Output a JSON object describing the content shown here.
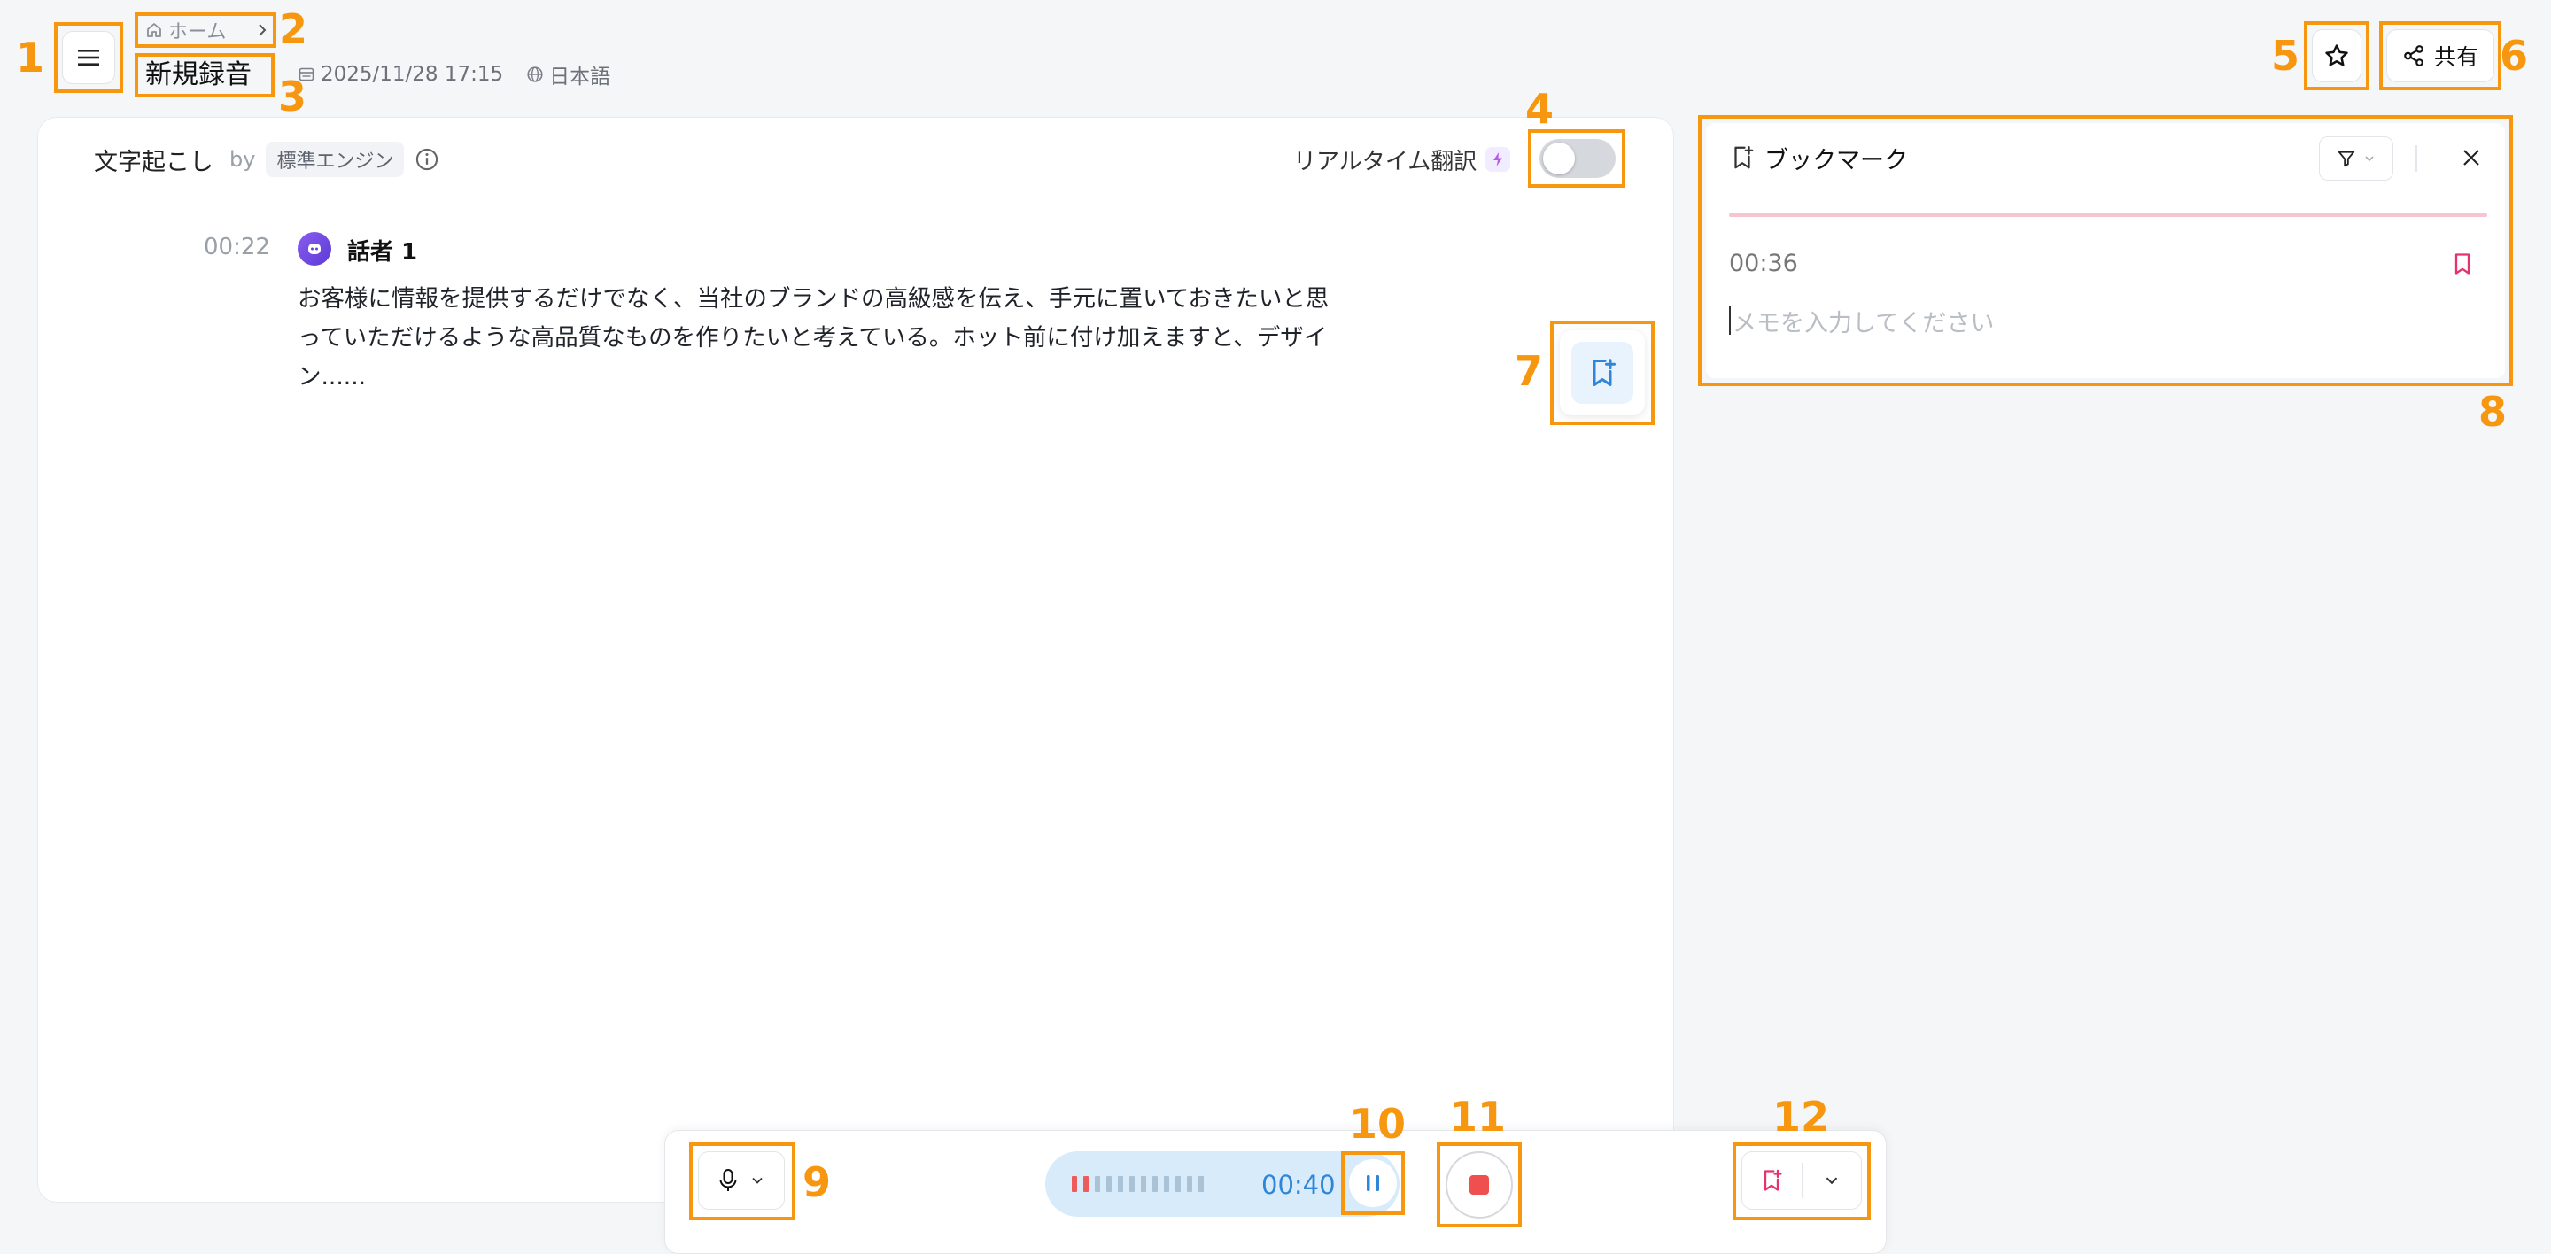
{
  "header": {
    "breadcrumb_home": "ホーム",
    "title": "新規録音",
    "date": "2025/11/28 17:15",
    "language": "日本語",
    "share_label": "共有"
  },
  "transcript": {
    "heading": "文字起こし",
    "by": "by",
    "engine": "標準エンジン",
    "realtime_label": "リアルタイム翻訳",
    "realtime_enabled": false,
    "entries": [
      {
        "time": "00:22",
        "speaker": "話者 1",
        "lines": [
          "お客様に情報を提供するだけでなく、当社のブランドの高級感を伝え、手元に置いておきたいと思",
          "っていただけるような高品質なものを作りたいと考えている。ホット前に付け加えますと、デザイ",
          "ン......"
        ]
      }
    ]
  },
  "bookmarks": {
    "title": "ブックマーク",
    "items": [
      {
        "time": "00:36",
        "memo_placeholder": "メモを入力してください"
      }
    ]
  },
  "player": {
    "elapsed": "00:40"
  },
  "annotations": [
    "1",
    "2",
    "3",
    "4",
    "5",
    "6",
    "7",
    "8",
    "9",
    "10",
    "11",
    "12"
  ],
  "colors": {
    "accent": "#f7970f",
    "bookmark_pink": "#e5336b",
    "brand_blue": "#2f86d8",
    "avatar_purple": "#7b4be0"
  }
}
